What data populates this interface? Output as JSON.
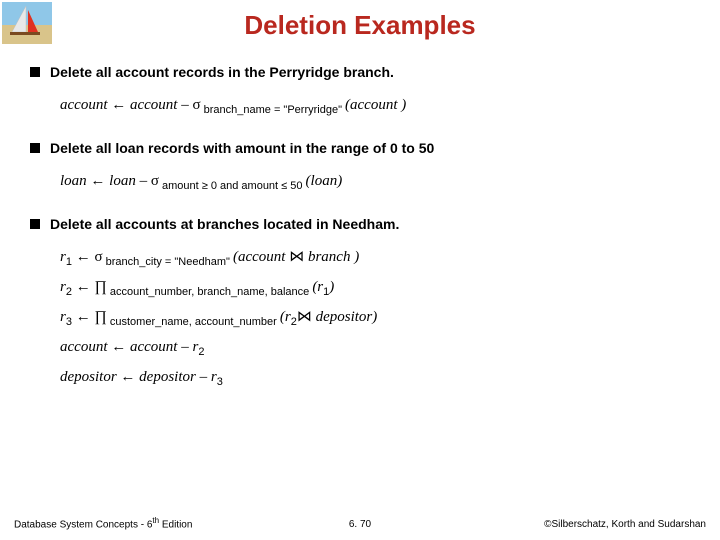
{
  "title": "Deletion Examples",
  "bullets": {
    "b1": "Delete all account records in the Perryridge branch.",
    "b2": "Delete all loan records with amount in the range of 0 to 50",
    "b3": "Delete all accounts at branches located in Needham."
  },
  "expr1": {
    "lhs": "account",
    "arrow": " ← ",
    "rhs1": "account – ",
    "sigma": "σ",
    "sub": " branch_name = \"Perryridge\" ",
    "tail": "(account )"
  },
  "expr2": {
    "lhs": "loan",
    "arrow": " ← ",
    "rhs1": "loan – ",
    "sigma": "σ",
    "sub": " amount ≥ 0 and amount ≤ 50 ",
    "tail": "(loan)"
  },
  "expr3": {
    "line1": {
      "r": "r",
      "n": "1",
      "arrow": " ← ",
      "sigma": "σ",
      "sub": " branch_city = \"Needham\" ",
      "tail_a": "(account ",
      "join": "⋈",
      "tail_b": " branch )"
    },
    "line2": {
      "r": "r",
      "n": "2",
      "arrow": " ← ",
      "pi": "∏",
      "sub": " account_number, branch_name, balance ",
      "tail_a": "(r",
      "tail_n": "1",
      "tail_b": ")"
    },
    "line3": {
      "r": "r",
      "n": "3",
      "arrow": " ← ",
      "pi": "∏",
      "sub": " customer_name, account_number ",
      "tail_a": "(r",
      "tail_na": "2",
      "join": "⋈",
      "tail_b": " depositor)"
    },
    "line4": {
      "a": "account",
      "arrow": " ← ",
      "b": "account – ",
      "r": "r",
      "n": "2"
    },
    "line5": {
      "a": "depositor",
      "arrow": " ← ",
      "b": "depositor – ",
      "r": "r",
      "n": "3"
    }
  },
  "footer": {
    "left_a": "Database System Concepts - 6",
    "left_b": " Edition",
    "th": "th",
    "center": "6. 70",
    "right": "©Silberschatz, Korth and Sudarshan"
  }
}
